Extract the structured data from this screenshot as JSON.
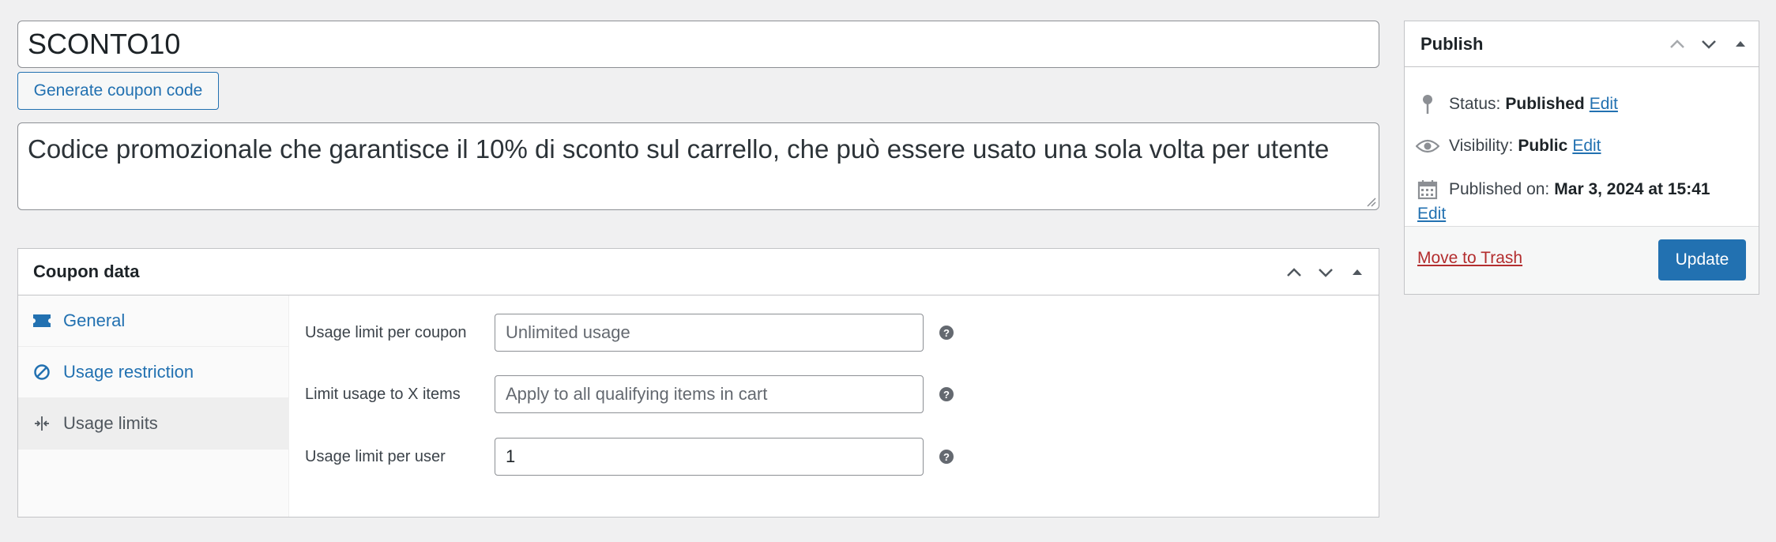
{
  "coupon": {
    "code": "SCONTO10",
    "generate_button": "Generate coupon code",
    "description": "Codice promozionale che garantisce il 10% di sconto sul carrello, che può essere usato una sola volta per utente"
  },
  "coupon_data": {
    "title": "Coupon data",
    "tabs": [
      {
        "label": "General",
        "icon": "ticket-icon"
      },
      {
        "label": "Usage restriction",
        "icon": "block-icon"
      },
      {
        "label": "Usage limits",
        "icon": "limits-icon",
        "active": true
      }
    ],
    "fields": [
      {
        "label": "Usage limit per coupon",
        "placeholder": "Unlimited usage",
        "value": ""
      },
      {
        "label": "Limit usage to X items",
        "placeholder": "Apply to all qualifying items in cart",
        "value": ""
      },
      {
        "label": "Usage limit per user",
        "placeholder": "",
        "value": "1"
      }
    ],
    "help_glyph": "?"
  },
  "publish": {
    "title": "Publish",
    "status_label": "Status:",
    "status_value": "Published",
    "visibility_label": "Visibility:",
    "visibility_value": "Public",
    "published_label": "Published on:",
    "published_value": "Mar 3, 2024 at 15:41",
    "edit_label": "Edit",
    "trash_label": "Move to Trash",
    "update_label": "Update"
  },
  "colors": {
    "accent": "#2271b1",
    "danger": "#b32d2e",
    "background": "#f0f0f1"
  }
}
